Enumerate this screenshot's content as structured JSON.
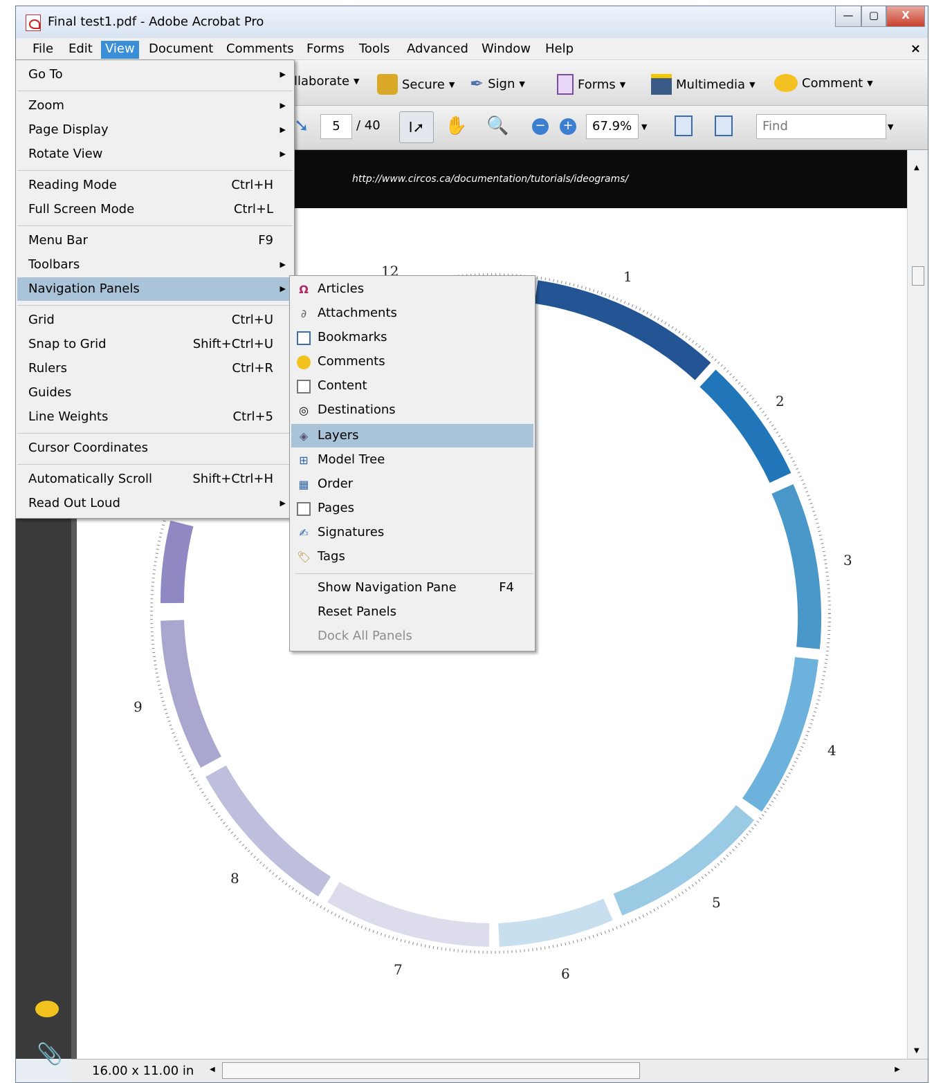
{
  "window": {
    "title": "Final test1.pdf - Adobe Acrobat Pro",
    "minimize": "—",
    "maximize": "▢",
    "close": "X"
  },
  "menubar": {
    "items": [
      "File",
      "Edit",
      "View",
      "Document",
      "Comments",
      "Forms",
      "Tools",
      "Advanced",
      "Window",
      "Help"
    ],
    "close_doc": "×"
  },
  "toolbar1": {
    "collaborate": "llaborate",
    "secure": "Secure",
    "sign": "Sign",
    "forms": "Forms",
    "multimedia": "Multimedia",
    "comment": "Comment"
  },
  "toolbar2": {
    "page_current": "5",
    "page_total": "/ 40",
    "zoom": "67.9%",
    "find_placeholder": "Find"
  },
  "document": {
    "banner_url": "http://www.circos.ca/documentation/tutorials/ideograms/"
  },
  "statusbar": {
    "page_size": "16.00 x 11.00 in"
  },
  "view_menu": {
    "items": [
      {
        "label": "Go To",
        "shortcut": "",
        "submenu": true
      },
      {
        "label": "Zoom",
        "shortcut": "",
        "submenu": true
      },
      {
        "label": "Page Display",
        "shortcut": "",
        "submenu": true
      },
      {
        "label": "Rotate View",
        "shortcut": "",
        "submenu": true
      },
      {
        "label": "Reading Mode",
        "shortcut": "Ctrl+H",
        "submenu": false
      },
      {
        "label": "Full Screen Mode",
        "shortcut": "Ctrl+L",
        "submenu": false
      },
      {
        "label": "Menu Bar",
        "shortcut": "F9",
        "submenu": false
      },
      {
        "label": "Toolbars",
        "shortcut": "",
        "submenu": true
      },
      {
        "label": "Navigation Panels",
        "shortcut": "",
        "submenu": true
      },
      {
        "label": "Grid",
        "shortcut": "Ctrl+U",
        "submenu": false
      },
      {
        "label": "Snap to Grid",
        "shortcut": "Shift+Ctrl+U",
        "submenu": false
      },
      {
        "label": "Rulers",
        "shortcut": "Ctrl+R",
        "submenu": false
      },
      {
        "label": "Guides",
        "shortcut": "",
        "submenu": false
      },
      {
        "label": "Line Weights",
        "shortcut": "Ctrl+5",
        "submenu": false
      },
      {
        "label": "Cursor Coordinates",
        "shortcut": "",
        "submenu": false
      },
      {
        "label": "Automatically Scroll",
        "shortcut": "Shift+Ctrl+H",
        "submenu": false
      },
      {
        "label": "Read Out Loud",
        "shortcut": "",
        "submenu": true
      }
    ]
  },
  "nav_panels_menu": {
    "items": [
      {
        "label": "Articles",
        "icon": "articles-icon"
      },
      {
        "label": "Attachments",
        "icon": "paperclip-icon"
      },
      {
        "label": "Bookmarks",
        "icon": "bookmark-icon"
      },
      {
        "label": "Comments",
        "icon": "speech-bubble-icon"
      },
      {
        "label": "Content",
        "icon": "content-icon"
      },
      {
        "label": "Destinations",
        "icon": "target-icon"
      },
      {
        "label": "Layers",
        "icon": "layers-icon"
      },
      {
        "label": "Model Tree",
        "icon": "tree-icon"
      },
      {
        "label": "Order",
        "icon": "order-icon"
      },
      {
        "label": "Pages",
        "icon": "pages-icon"
      },
      {
        "label": "Signatures",
        "icon": "signature-icon"
      },
      {
        "label": "Tags",
        "icon": "tag-icon"
      }
    ],
    "show_nav_pane": "Show Navigation Pane",
    "show_nav_pane_shortcut": "F4",
    "reset_panels": "Reset Panels",
    "dock_all": "Dock All Panels"
  },
  "circos_labels": {
    "numbers": [
      "1",
      "2",
      "3",
      "4",
      "5",
      "6",
      "7",
      "8",
      "9",
      "12"
    ]
  }
}
